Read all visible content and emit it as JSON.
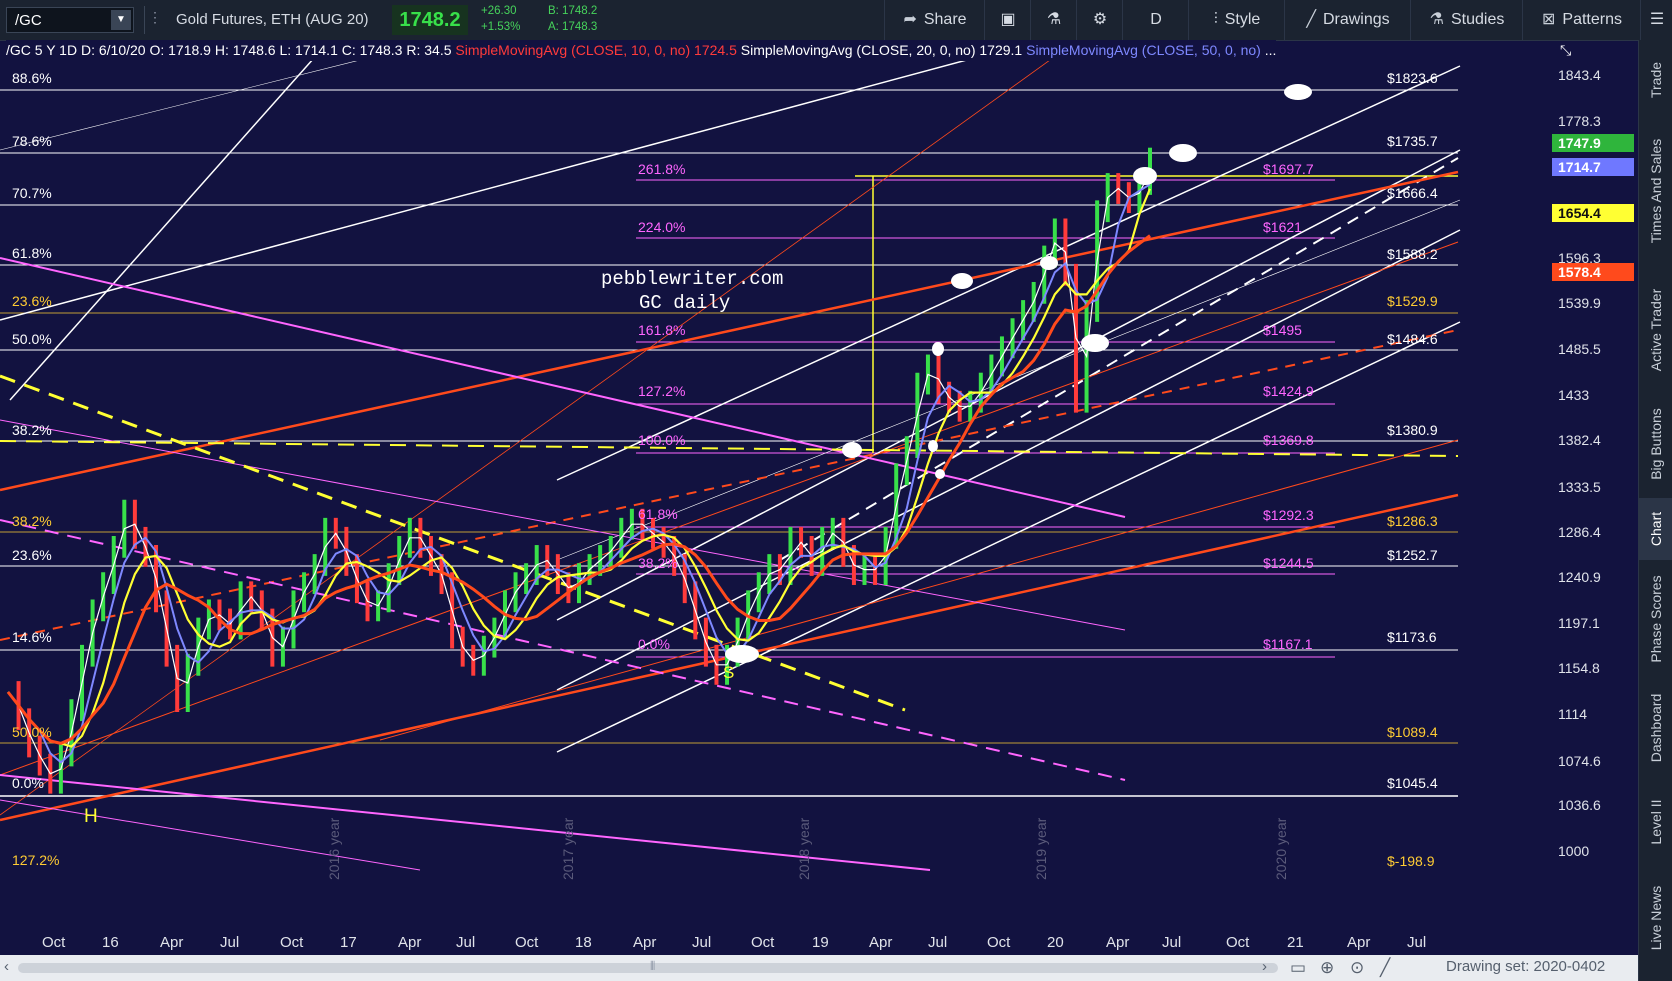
{
  "toolbar": {
    "symbol": "/GC",
    "title": "Gold Futures, ETH (AUG 20)",
    "last": "1748.2",
    "change": "+26.30",
    "change_pct": "+1.53%",
    "bid": "B: 1748.2",
    "ask": "A: 1748.3",
    "share": "Share",
    "timeframe": "D",
    "style": "Style",
    "drawings": "Drawings",
    "studies": "Studies",
    "patterns": "Patterns"
  },
  "info": {
    "symbol": "/GC 5 Y 1D",
    "date": "D: 6/10/20",
    "open": "O: 1718.9",
    "high": "H: 1748.6",
    "low": "L: 1714.1",
    "close": "C: 1748.3",
    "range": "R: 34.5",
    "sma10_label": "SimpleMovingAvg (CLOSE, 10, 0, no)",
    "sma10_value": "1724.5",
    "sma20_label": "SimpleMovingAvg (CLOSE, 20, 0, no)",
    "sma20_value": "1729.1",
    "sma50_label": "SimpleMovingAvg (CLOSE, 50, 0, no)",
    "ellipsis": "..."
  },
  "colors": {
    "background": "#121240",
    "toolbar": "#1b2330",
    "sma10": "#ffffff",
    "sma20": "#7e88ff",
    "sma50": "#ffff33",
    "sma200": "#ff4a1c",
    "fib": "#ff66ff",
    "price_up": "#38e04a"
  },
  "watermark": [
    "pebblewriter.com",
    "GC daily"
  ],
  "pattern_labels": {
    "h": "H",
    "s": "S"
  },
  "fib_left": [
    {
      "label": "88.6%",
      "color": "#ffffff"
    },
    {
      "label": "78.6%",
      "color": "#ffffff"
    },
    {
      "label": "70.7%",
      "color": "#ffffff"
    },
    {
      "label": "61.8%",
      "color": "#ffffff"
    },
    {
      "label": "23.6%",
      "color": "#ffcc33"
    },
    {
      "label": "50.0%",
      "color": "#ffffff"
    },
    {
      "label": "38.2%",
      "color": "#ffffff"
    },
    {
      "label": "38.2%",
      "color": "#ffcc33"
    },
    {
      "label": "23.6%",
      "color": "#ffffff"
    },
    {
      "label": "14.6%",
      "color": "#ffffff"
    },
    {
      "label": "50.0%",
      "color": "#ffcc33"
    },
    {
      "label": "0.0%",
      "color": "#ffffff"
    },
    {
      "label": "127.2%",
      "color": "#ffcc33"
    }
  ],
  "fib_mid": [
    "261.8%",
    "224.0%",
    "161.8%",
    "127.2%",
    "100.0%",
    "61.8%",
    "38.2%",
    "0.0%"
  ],
  "fib_right": [
    {
      "label": "$1823.6",
      "color": "#ffffff"
    },
    {
      "label": "$1735.7",
      "color": "#ffffff"
    },
    {
      "label": "$1697.7",
      "color": "#ff66ff"
    },
    {
      "label": "$1666.4",
      "color": "#ffffff"
    },
    {
      "label": "$1621",
      "color": "#ff66ff"
    },
    {
      "label": "$1588.2",
      "color": "#ffffff"
    },
    {
      "label": "$1529.9",
      "color": "#ffcc33"
    },
    {
      "label": "$1495",
      "color": "#ff66ff"
    },
    {
      "label": "$1484.6",
      "color": "#ffffff"
    },
    {
      "label": "$1424.9",
      "color": "#ff66ff"
    },
    {
      "label": "$1380.9",
      "color": "#ffffff"
    },
    {
      "label": "$1369.8",
      "color": "#ff66ff"
    },
    {
      "label": "$1292.3",
      "color": "#ff66ff"
    },
    {
      "label": "$1286.3",
      "color": "#ffcc33"
    },
    {
      "label": "$1252.7",
      "color": "#ffffff"
    },
    {
      "label": "$1244.5",
      "color": "#ff66ff"
    },
    {
      "label": "$1173.6",
      "color": "#ffffff"
    },
    {
      "label": "$1167.1",
      "color": "#ff66ff"
    },
    {
      "label": "$1089.4",
      "color": "#ffcc33"
    },
    {
      "label": "$1045.4",
      "color": "#ffffff"
    },
    {
      "label": "$-198.9",
      "color": "#ffcc33"
    }
  ],
  "yaxis_ticks": [
    "1843.4",
    "1778.3",
    "1596.3",
    "1539.9",
    "1485.5",
    "1433",
    "1382.4",
    "1333.5",
    "1286.4",
    "1240.9",
    "1197.1",
    "1154.8",
    "1114",
    "1074.6",
    "1036.6",
    "1000"
  ],
  "price_tags": [
    {
      "label": "1747.9",
      "bg": "#2fb53c",
      "fg": "#ffffff"
    },
    {
      "label": "1714.7",
      "bg": "#6f78ff",
      "fg": "#ffffff"
    },
    {
      "label": "1654.4",
      "bg": "#ffff33",
      "fg": "#111111"
    },
    {
      "label": "1578.4",
      "bg": "#ff4a1c",
      "fg": "#ffffff"
    }
  ],
  "xaxis_ticks": [
    "Oct",
    "16",
    "Apr",
    "Jul",
    "Oct",
    "17",
    "Apr",
    "Jul",
    "Oct",
    "18",
    "Apr",
    "Jul",
    "Oct",
    "19",
    "Apr",
    "Jul",
    "Oct",
    "20",
    "Apr",
    "Jul",
    "Oct",
    "21",
    "Apr",
    "Jul"
  ],
  "year_marks": [
    "2016 year",
    "2017 year",
    "2018 year",
    "2019 year",
    "2020 year"
  ],
  "side_tabs": [
    "Trade",
    "Times And Sales",
    "Active Trader",
    "Big Buttons",
    "Chart",
    "Phase Scores",
    "Dashboard",
    "Level II",
    "Live News"
  ],
  "drawing_set": "Drawing set: 2020-0402",
  "price_series": [
    1160,
    1130,
    1100,
    1080,
    1060,
    1090,
    1140,
    1200,
    1250,
    1280,
    1320,
    1360,
    1330,
    1310,
    1260,
    1200,
    1150,
    1190,
    1230,
    1250,
    1240,
    1230,
    1270,
    1260,
    1240,
    1200,
    1220,
    1260,
    1280,
    1300,
    1340,
    1330,
    1300,
    1270,
    1250,
    1260,
    1290,
    1320,
    1340,
    1320,
    1300,
    1280,
    1220,
    1200,
    1190,
    1210,
    1230,
    1260,
    1280,
    1290,
    1310,
    1300,
    1280,
    1270,
    1290,
    1300,
    1310,
    1320,
    1340,
    1350,
    1340,
    1330,
    1320,
    1300,
    1270,
    1230,
    1200,
    1180,
    1200,
    1230,
    1260,
    1280,
    1300,
    1290,
    1330,
    1320,
    1300,
    1330,
    1340,
    1310,
    1290,
    1300,
    1290,
    1330,
    1400,
    1430,
    1500,
    1520,
    1490,
    1480,
    1470,
    1480,
    1500,
    1520,
    1540,
    1560,
    1580,
    1600,
    1640,
    1670,
    1620,
    1480,
    1580,
    1690,
    1720,
    1710,
    1700,
    1720,
    1748
  ]
}
